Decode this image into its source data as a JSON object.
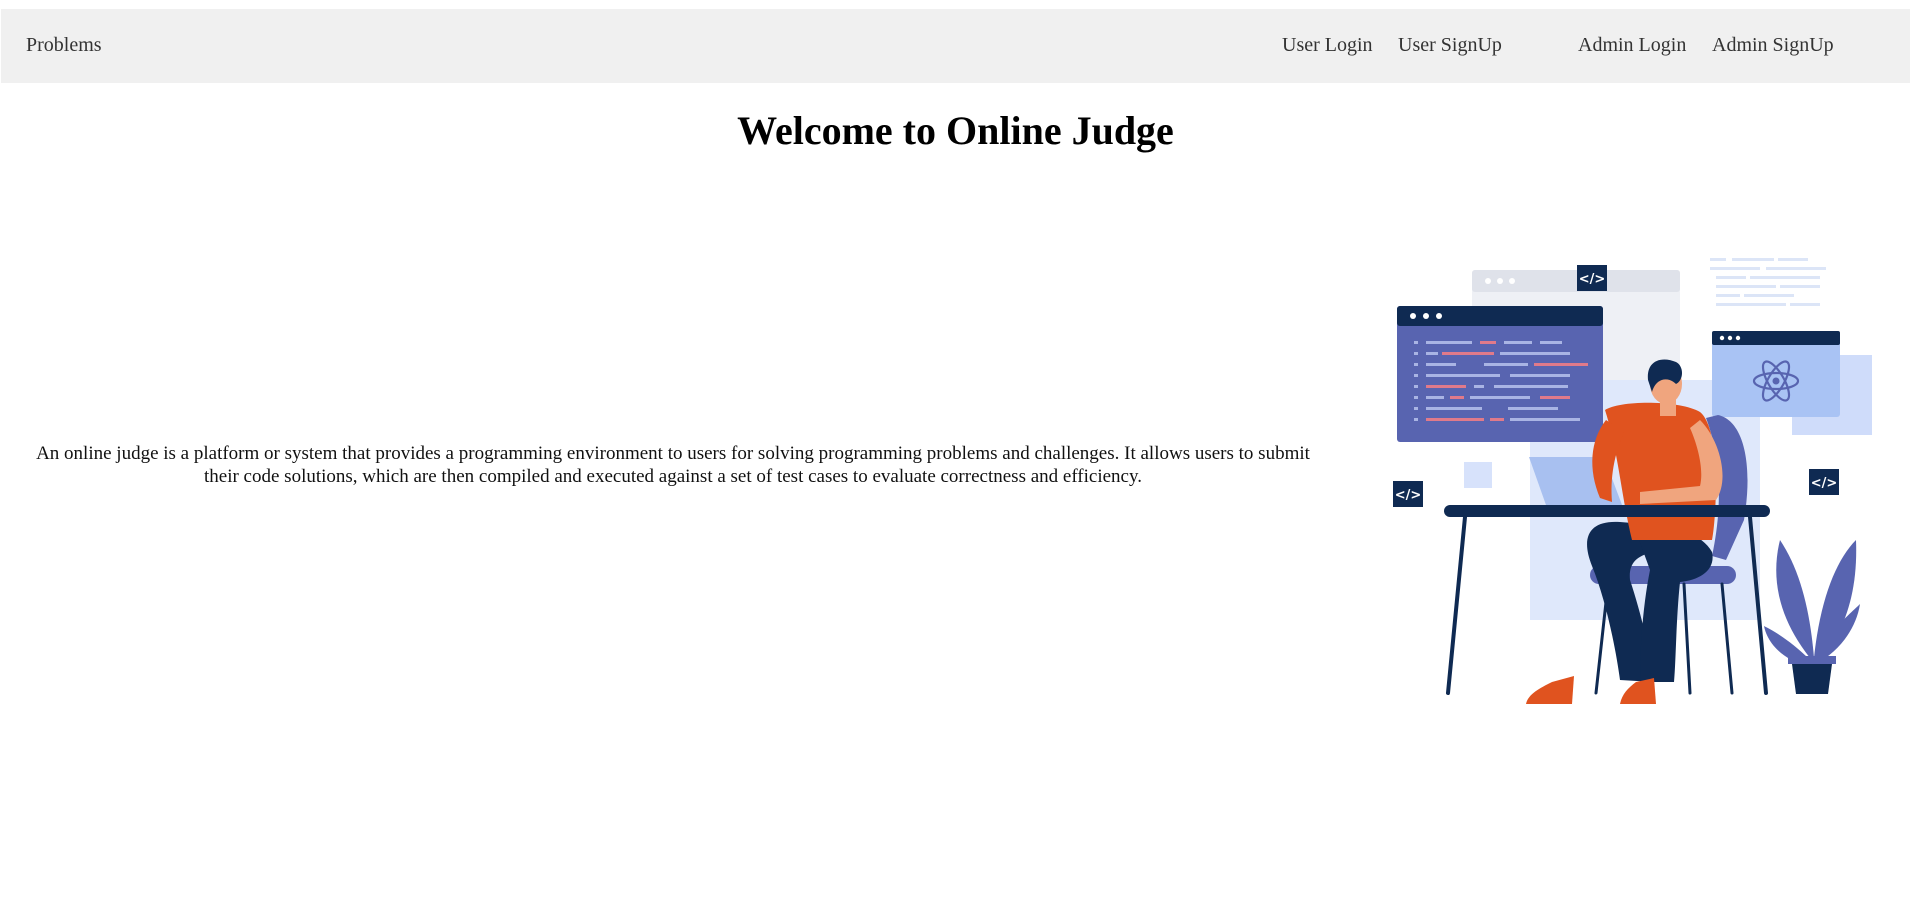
{
  "nav": {
    "problems": "Problems",
    "user_login": "User Login",
    "user_signup": "User SignUp",
    "admin_login": "Admin Login",
    "admin_signup": "Admin SignUp"
  },
  "hero": {
    "title": "Welcome to Online Judge",
    "description": "An online judge is a platform or system that provides a programming environment to users for solving programming problems and challenges. It allows users to submit their code solutions, which are then compiled and executed against a set of test cases to evaluate correctness and efficiency.",
    "illustration_icon": "developer-at-desk-illustration",
    "code_tag_text": "</>"
  },
  "colors": {
    "navbar_bg": "#f0f0f0",
    "navy": "#0f2a52",
    "orange": "#e0531f",
    "indigo": "#5864b0",
    "light_blue": "#c9d8f7"
  }
}
